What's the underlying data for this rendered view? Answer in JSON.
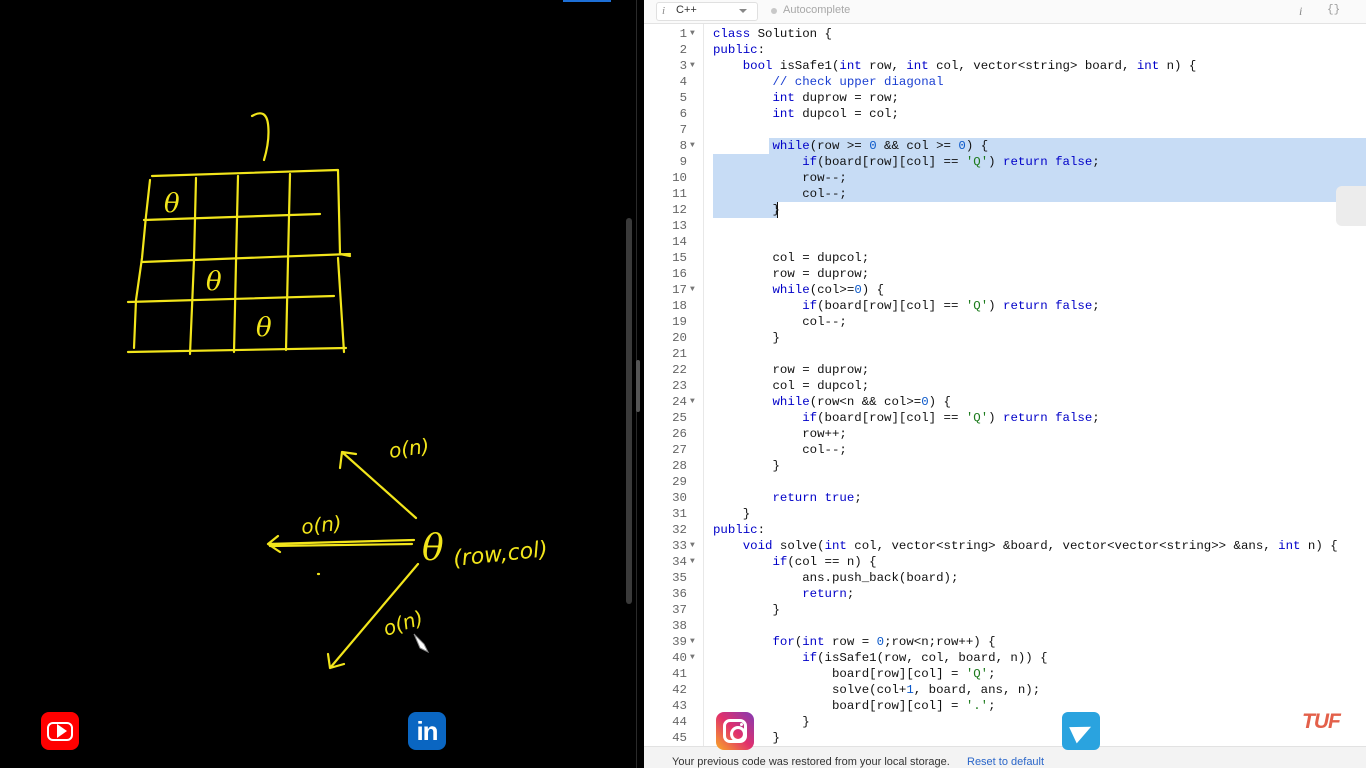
{
  "editor": {
    "language": "C++",
    "language_info_icon": "i",
    "autocomplete_label": "Autocomplete",
    "toolbar_info_icon": "i",
    "toolbar_format_icon": "{}",
    "status_message": "Your previous code was restored from your local storage.",
    "reset_link": "Reset to default",
    "watermark": "TUF",
    "selected_lines": [
      8,
      12
    ],
    "lines": [
      {
        "n": "1",
        "fold": true,
        "text": "class Solution {"
      },
      {
        "n": "2",
        "fold": false,
        "text": "public:"
      },
      {
        "n": "3",
        "fold": true,
        "text": "    bool isSafe1(int row, int col, vector<string> board, int n) {"
      },
      {
        "n": "4",
        "fold": false,
        "text": "        // check upper diagonal"
      },
      {
        "n": "5",
        "fold": false,
        "text": "        int duprow = row;"
      },
      {
        "n": "6",
        "fold": false,
        "text": "        int dupcol = col;"
      },
      {
        "n": "7",
        "fold": false,
        "text": ""
      },
      {
        "n": "8",
        "fold": true,
        "text": "        while(row >= 0 && col >= 0) {"
      },
      {
        "n": "9",
        "fold": false,
        "text": "            if(board[row][col] == 'Q') return false;"
      },
      {
        "n": "10",
        "fold": false,
        "text": "            row--;"
      },
      {
        "n": "11",
        "fold": false,
        "text": "            col--;"
      },
      {
        "n": "12",
        "fold": false,
        "text": "        }"
      },
      {
        "n": "13",
        "fold": false,
        "text": ""
      },
      {
        "n": "14",
        "fold": false,
        "text": ""
      },
      {
        "n": "15",
        "fold": false,
        "text": "        col = dupcol;"
      },
      {
        "n": "16",
        "fold": false,
        "text": "        row = duprow;"
      },
      {
        "n": "17",
        "fold": true,
        "text": "        while(col>=0) {"
      },
      {
        "n": "18",
        "fold": false,
        "text": "            if(board[row][col] == 'Q') return false;"
      },
      {
        "n": "19",
        "fold": false,
        "text": "            col--;"
      },
      {
        "n": "20",
        "fold": false,
        "text": "        }"
      },
      {
        "n": "21",
        "fold": false,
        "text": ""
      },
      {
        "n": "22",
        "fold": false,
        "text": "        row = duprow;"
      },
      {
        "n": "23",
        "fold": false,
        "text": "        col = dupcol;"
      },
      {
        "n": "24",
        "fold": true,
        "text": "        while(row<n && col>=0) {"
      },
      {
        "n": "25",
        "fold": false,
        "text": "            if(board[row][col] == 'Q') return false;"
      },
      {
        "n": "26",
        "fold": false,
        "text": "            row++;"
      },
      {
        "n": "27",
        "fold": false,
        "text": "            col--;"
      },
      {
        "n": "28",
        "fold": false,
        "text": "        }"
      },
      {
        "n": "29",
        "fold": false,
        "text": ""
      },
      {
        "n": "30",
        "fold": false,
        "text": "        return true;"
      },
      {
        "n": "31",
        "fold": false,
        "text": "    }"
      },
      {
        "n": "32",
        "fold": false,
        "text": "public:"
      },
      {
        "n": "33",
        "fold": true,
        "text": "    void solve(int col, vector<string> &board, vector<vector<string>> &ans, int n) {"
      },
      {
        "n": "34",
        "fold": true,
        "text": "        if(col == n) {"
      },
      {
        "n": "35",
        "fold": false,
        "text": "            ans.push_back(board);"
      },
      {
        "n": "36",
        "fold": false,
        "text": "            return;"
      },
      {
        "n": "37",
        "fold": false,
        "text": "        }"
      },
      {
        "n": "38",
        "fold": false,
        "text": ""
      },
      {
        "n": "39",
        "fold": true,
        "text": "        for(int row = 0;row<n;row++) {"
      },
      {
        "n": "40",
        "fold": true,
        "text": "            if(isSafe1(row, col, board, n)) {"
      },
      {
        "n": "41",
        "fold": false,
        "text": "                board[row][col] = 'Q';"
      },
      {
        "n": "42",
        "fold": false,
        "text": "                solve(col+1, board, ans, n);"
      },
      {
        "n": "43",
        "fold": false,
        "text": "                board[row][col] = '.';"
      },
      {
        "n": "44",
        "fold": false,
        "text": "            }"
      },
      {
        "n": "45",
        "fold": false,
        "text": "        }"
      }
    ]
  },
  "whiteboard": {
    "ink_color": "#f2e51b",
    "queen_symbol": "θ",
    "grid_queens": [
      [
        0,
        0
      ],
      [
        2,
        1
      ],
      [
        3,
        2
      ]
    ],
    "annotation_top_right": "o(n)",
    "annotation_left": "o(n)",
    "annotation_bottom": "o(n)",
    "position_label": "(row,col)"
  },
  "socials": {
    "youtube": "youtube-icon",
    "linkedin_text": "in",
    "instagram": "instagram-icon",
    "telegram": "telegram-icon"
  },
  "colors": {
    "selection": "#c7dcf5",
    "keyword": "#0000c8",
    "string": "#1c7a1c",
    "brand": "#e3604a"
  }
}
